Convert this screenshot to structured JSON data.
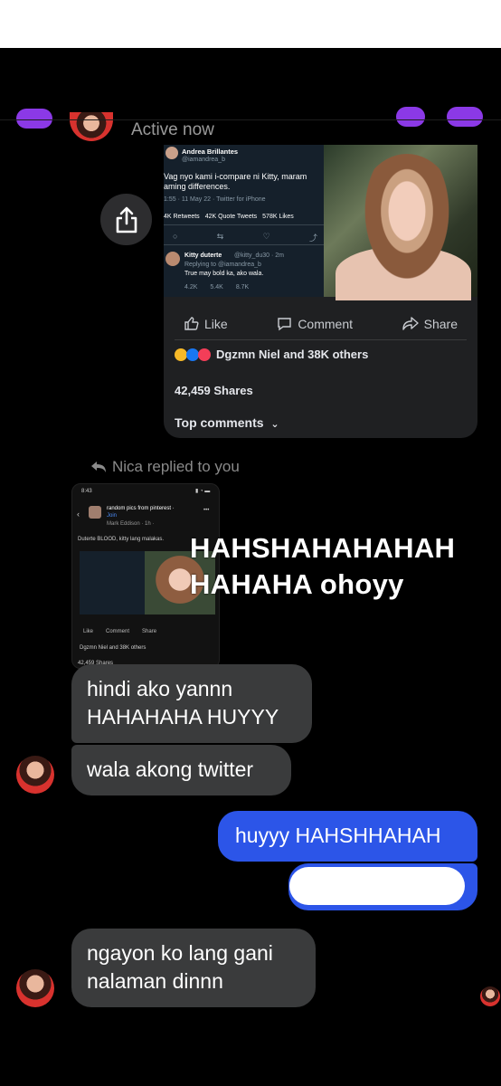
{
  "header": {
    "status": "Active now"
  },
  "shared_post": {
    "tweet": {
      "author": "Andrea Brillantes",
      "handle": "@iamandrea_b",
      "text": "Vag nyo kami i-compare ni Kitty, maram aming differences.",
      "meta": "1:55 · 11 May 22 · Twitter for iPhone",
      "stats": {
        "retweets": "4K Retweets",
        "quotes": "42K Quote Tweets",
        "likes": "578K Likes"
      },
      "reply_author": "Kitty duterte",
      "reply_handle": "@kitty_du30 · 2m",
      "replying_to": "Replying to @iamandrea_b",
      "reply_text": "True may bold ka, ako wala.",
      "reply_stats": {
        "replies": "4.2K",
        "retweets": "5.4K",
        "likes": "8.7K"
      }
    },
    "actions": {
      "like": "Like",
      "comment": "Comment",
      "share": "Share"
    },
    "reactions": "Dgzmn Niel and 38K others",
    "shares": "42,459 Shares",
    "top_comments": "Top comments"
  },
  "reply": {
    "label": "Nica replied to you",
    "thumb": {
      "time": "8:43",
      "group": "random pics from pinterest ·",
      "join": "Join",
      "poster": "Mark Eddison · 1h ·",
      "caption": "Duterte BLOOD, kitty lang malakas.",
      "like": "Like",
      "comment": "Comment",
      "share": "Share",
      "reactions": "Dgzmn Niel and 38K others",
      "shares": "42,459 Shares"
    },
    "overlay_line1": "HAHSHAHAHAHAH",
    "overlay_line2": "HAHAHA ohoyy"
  },
  "messages": [
    {
      "side": "in",
      "line1": "hindi ako yannn",
      "line2": "HAHAHAHA HUYYY"
    },
    {
      "side": "in",
      "text": "wala akong twitter"
    },
    {
      "side": "out",
      "text": "huyyy HAHSHHAHAH"
    },
    {
      "side": "out",
      "text": ""
    },
    {
      "side": "in",
      "line1": "ngayon ko lang gani",
      "line2": "nalaman dinnn"
    }
  ],
  "colors": {
    "outgoing": "#2c55e8",
    "incoming": "#3a3b3c",
    "accent": "#8b39e6",
    "background": "#000000"
  }
}
